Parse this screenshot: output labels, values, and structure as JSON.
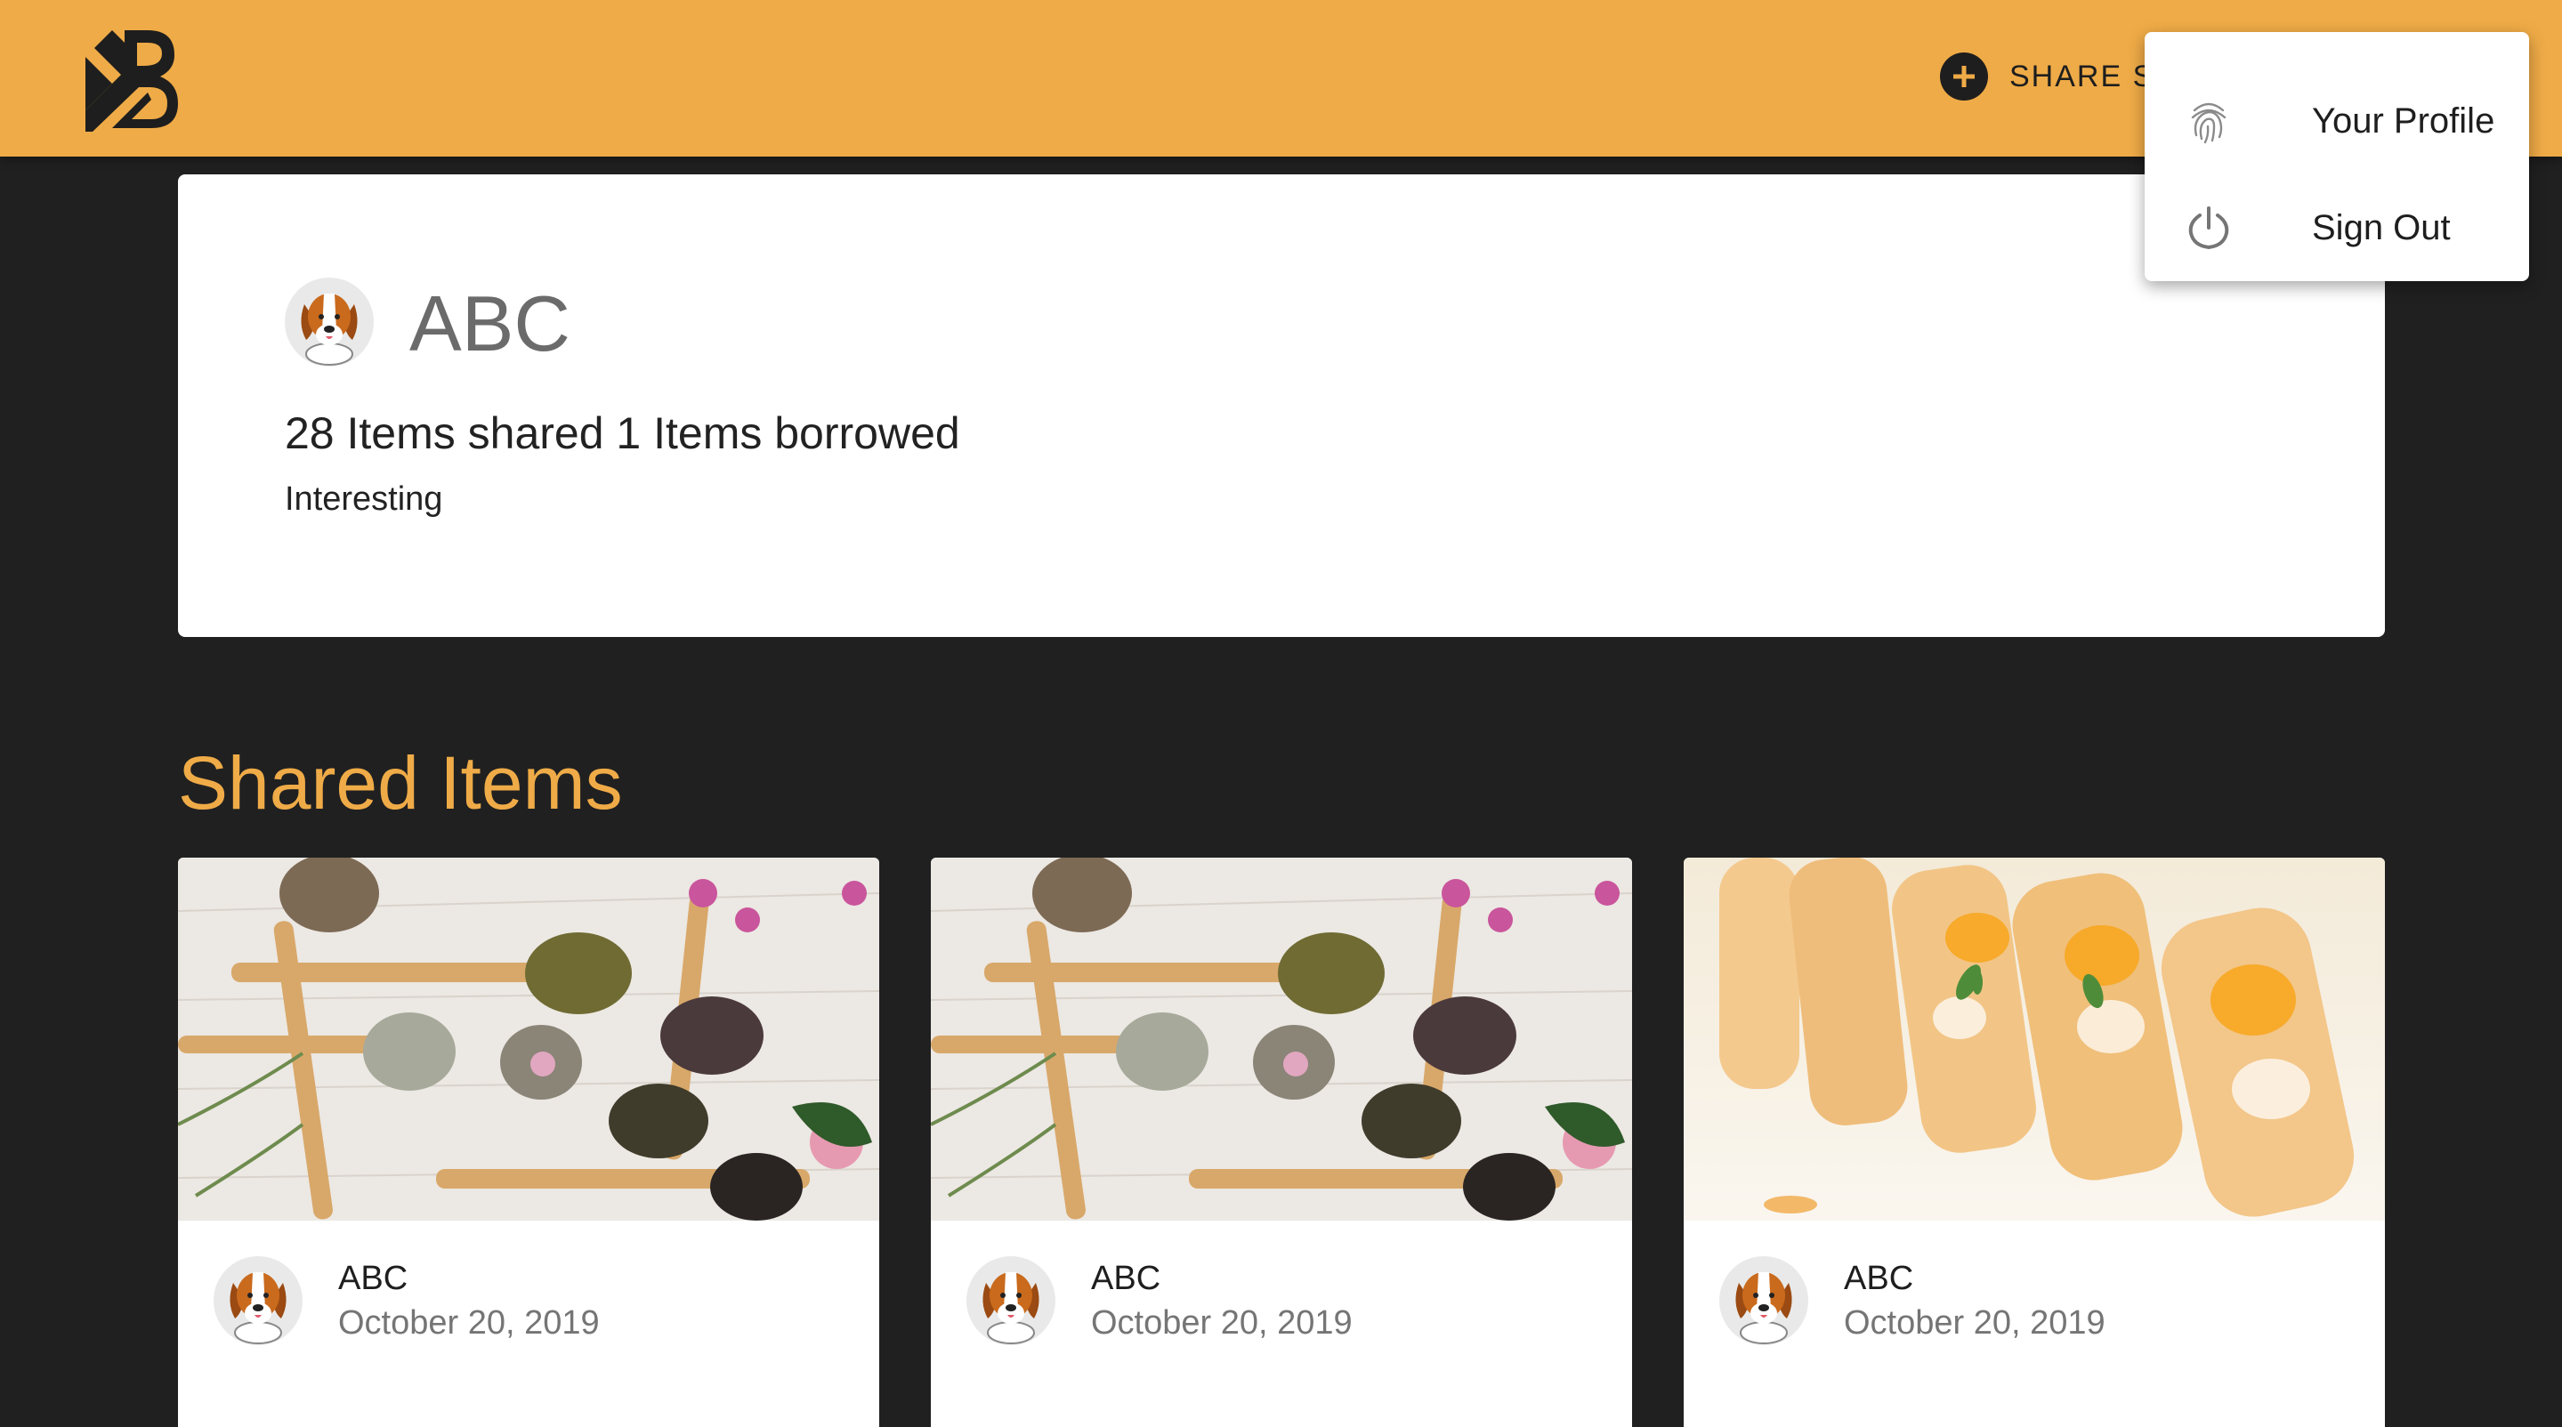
{
  "header": {
    "logo_icon": "boomtown-logo-icon",
    "share_label": "SHARE S",
    "share_icon": "plus-circle-icon",
    "accent_color": "#EFAB47"
  },
  "menu": {
    "items": [
      {
        "label": "Your Profile",
        "icon": "fingerprint-icon"
      },
      {
        "label": "Sign Out",
        "icon": "power-icon"
      }
    ]
  },
  "profile": {
    "name": "ABC",
    "stats": "28 Items shared 1 Items borrowed",
    "bio": "Interesting",
    "avatar": "beagle-avatar-icon"
  },
  "shared_items": {
    "title": "Shared Items",
    "cards": [
      {
        "image": "tea-spoons-image",
        "owner": "ABC",
        "date": "October 20, 2019"
      },
      {
        "image": "tea-spoons-image",
        "owner": "ABC",
        "date": "October 20, 2019"
      },
      {
        "image": "spring-rolls-image",
        "owner": "ABC",
        "date": "October 20, 2019"
      }
    ]
  }
}
